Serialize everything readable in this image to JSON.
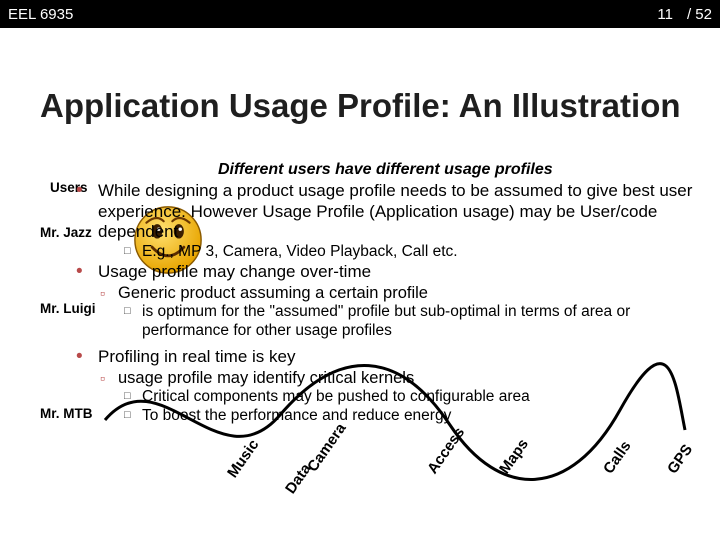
{
  "topbar": {
    "course": "EEL 6935",
    "page_num": "11",
    "page_sep": "/ 52"
  },
  "title": "Application Usage Profile: An Illustration",
  "subtitle": "Different users have different usage profiles",
  "labels": {
    "users": "Users",
    "jazz": "Mr. Jazz",
    "luigi": "Mr. Luigi",
    "mtb": "Mr. MTB"
  },
  "bullets": {
    "b0": "While designing a product usage profile needs to be assumed to give best user experience. However Usage Profile (Application usage) may be User/code dependent",
    "b0a": "E.g., MP 3, Camera, Video Playback, Call etc.",
    "b1": "Usage profile may change over-time",
    "b1a": "Generic product assuming a certain profile",
    "b1a1": "is optimum for the \"assumed\" profile but sub-optimal in terms of area or performance for other usage profiles",
    "b2": "Profiling in real time is key",
    "b2a": "usage profile may identify critical kernels",
    "b2a1": "Critical components may be pushed to configurable area",
    "b2a2": "To boost the performance and reduce energy"
  },
  "axis": {
    "music": "Music",
    "data": "Data",
    "camera": "Camera",
    "access": "Access",
    "maps": "Maps",
    "calls": "Calls",
    "gps": "GPS"
  }
}
